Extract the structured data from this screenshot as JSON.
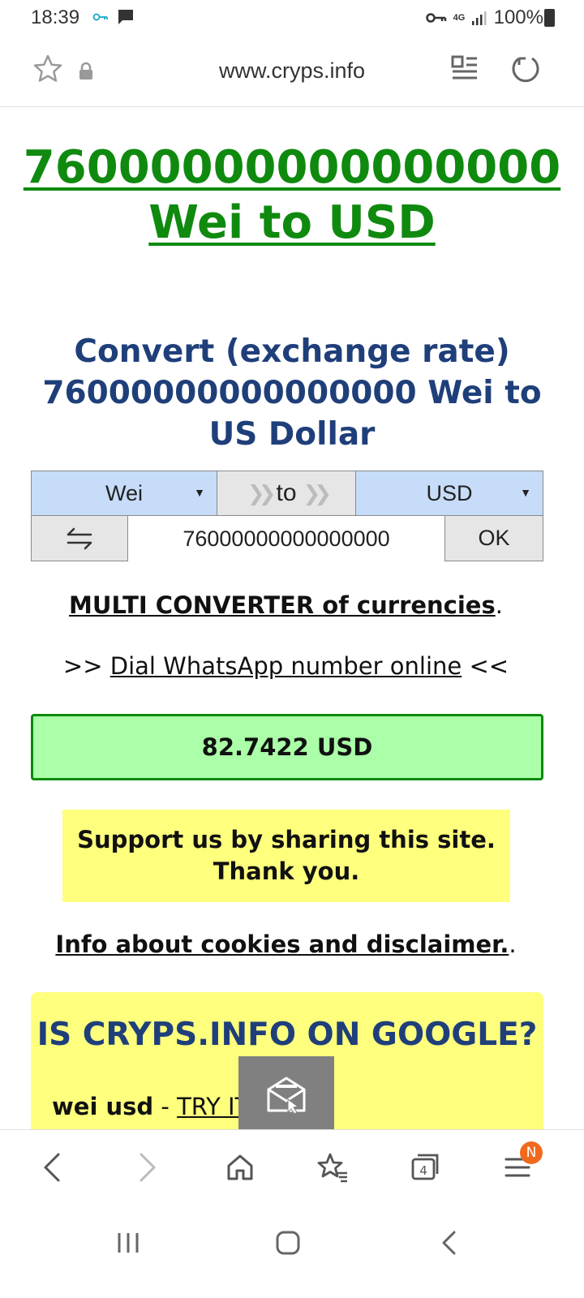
{
  "status_bar": {
    "time": "18:39",
    "battery_text": "100%",
    "network": "4G",
    "icons": [
      "vpn-key-icon",
      "message-icon",
      "key-icon",
      "signal-icon",
      "battery-icon"
    ]
  },
  "browser": {
    "url": "www.cryps.info",
    "icons": [
      "bookmark-star-icon",
      "lock-icon",
      "reader-mode-icon",
      "reload-icon"
    ]
  },
  "page": {
    "main_title": "76000000000000000 Wei to USD",
    "convert_heading": "Convert (exchange rate) 76000000000000000 Wei to US Dollar",
    "converter": {
      "from_currency": "Wei",
      "to_label": "to",
      "to_currency": "USD",
      "amount": "76000000000000000",
      "ok_label": "OK"
    },
    "multi_converter_link": "MULTI CONVERTER of currencies",
    "multi_converter_suffix": ".",
    "whatsapp_prefix": ">>",
    "whatsapp_link": "Dial WhatsApp number online",
    "whatsapp_suffix": "<<",
    "result": "82.7422 USD",
    "support_line1": "Support us by sharing this site.",
    "support_line2": "Thank you.",
    "cookies_link": "Info about cookies and disclaimer.",
    "cookies_suffix": ".",
    "google_heading": "IS CRYPS.INFO ON GOOGLE?",
    "google_query": "wei usd",
    "google_sep": " - ",
    "google_try": "TRY IT"
  },
  "bottom_nav": {
    "items": [
      "back-icon",
      "forward-icon",
      "home-icon",
      "bookmarks-icon",
      "tabs-icon",
      "menu-icon"
    ],
    "tabs_count": "4",
    "menu_badge": "N"
  },
  "colors": {
    "title_green": "#0f8a0f",
    "heading_blue": "#1f3f7a",
    "result_bg": "#aaffa8",
    "highlight_yellow": "#ffff7e",
    "select_blue": "#c6dcf8",
    "badge_orange": "#f06a1e"
  }
}
